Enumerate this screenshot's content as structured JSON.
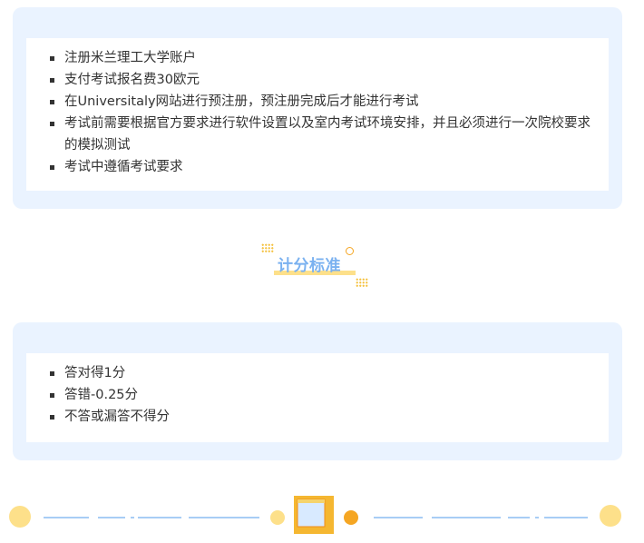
{
  "section1": {
    "items": [
      "注册米兰理工大学账户",
      "支付考试报名费30欧元",
      "在Universitaly网站进行预注册，预注册完成后才能进行考试",
      "考试前需要根据官方要求进行软件设置以及室内考试环境安排，并且必须进行一次院校要求的模拟测试",
      "考试中遵循考试要求"
    ]
  },
  "section_title": "计分标准",
  "section2": {
    "items": [
      "答对得1分",
      "答错-0.25分",
      "不答或漏答不得分"
    ]
  },
  "colors": {
    "card_bg": "#eaf3ff",
    "title": "#7ab1f0",
    "accent_yellow": "#fde08a",
    "accent_orange": "#f5a623"
  }
}
